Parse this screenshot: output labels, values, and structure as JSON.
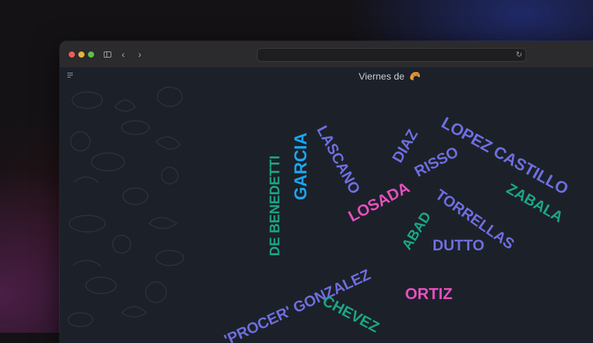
{
  "browser": {
    "url": "",
    "icons": [
      "sidebar-icon",
      "chevron-left-icon",
      "chevron-right-icon",
      "reload-icon"
    ]
  },
  "page": {
    "title": "Viernes de",
    "title_icon": "croissant-icon",
    "menu_icon": "menu-icon"
  },
  "colors": {
    "purple": "#6e6ee0",
    "teal": "#1ba686",
    "blue": "#1aa6f0",
    "pink": "#e64fc0"
  },
  "words": [
    {
      "text": "LOPEZ CASTILLO",
      "color": "#6e6ee0"
    },
    {
      "text": "LASCANO",
      "color": "#6e6ee0"
    },
    {
      "text": "DIAZ",
      "color": "#6e6ee0"
    },
    {
      "text": "GARCIA",
      "color": "#1aa6f0"
    },
    {
      "text": "DE BENEDETTI",
      "color": "#1ba686"
    },
    {
      "text": "RISSO",
      "color": "#6e6ee0"
    },
    {
      "text": "ZABALA",
      "color": "#1ba686"
    },
    {
      "text": "LOSADA",
      "color": "#e64fc0"
    },
    {
      "text": "TORRELLAS",
      "color": "#6e6ee0"
    },
    {
      "text": "ABAD",
      "color": "#1ba686"
    },
    {
      "text": "DUTTO",
      "color": "#6e6ee0"
    },
    {
      "text": "'PROCER' GONZALEZ",
      "color": "#6e6ee0"
    },
    {
      "text": "ORTIZ",
      "color": "#e64fc0"
    },
    {
      "text": "CHEVEZ",
      "color": "#1ba686"
    }
  ]
}
